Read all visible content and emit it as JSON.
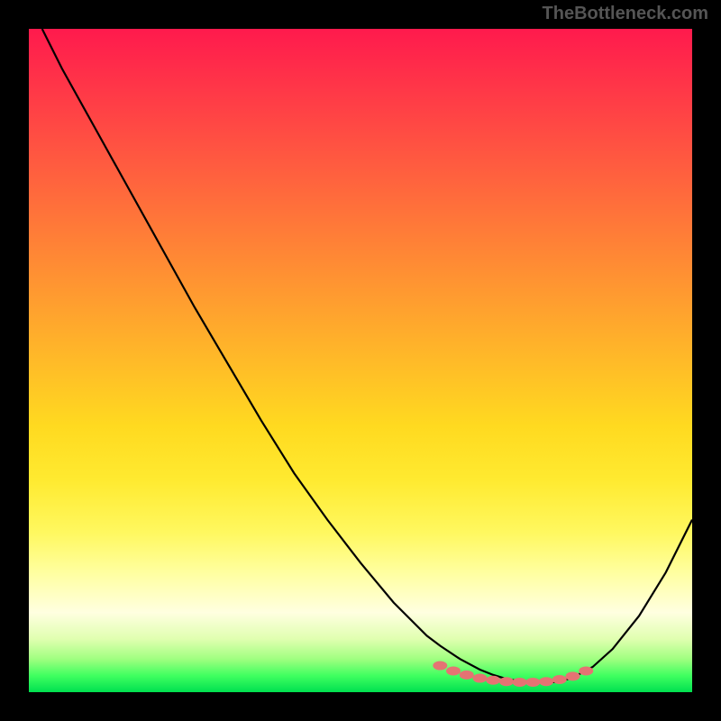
{
  "watermark": "TheBottleneck.com",
  "chart_data": {
    "type": "line",
    "title": "",
    "xlabel": "",
    "ylabel": "",
    "xlim": [
      0,
      100
    ],
    "ylim": [
      0,
      100
    ],
    "curve": {
      "x": [
        2,
        5,
        10,
        15,
        20,
        25,
        30,
        35,
        40,
        45,
        50,
        55,
        60,
        62,
        65,
        68,
        70,
        72,
        75,
        78,
        80,
        82,
        85,
        88,
        92,
        96,
        100
      ],
      "y": [
        100,
        94,
        85,
        76,
        67,
        58,
        49.5,
        41,
        33,
        26,
        19.5,
        13.5,
        8.5,
        7,
        5,
        3.4,
        2.6,
        2.0,
        1.5,
        1.4,
        1.6,
        2.2,
        3.8,
        6.5,
        11.5,
        18,
        26
      ]
    },
    "optimal_points": {
      "x": [
        62,
        64,
        66,
        68,
        70,
        72,
        74,
        76,
        78,
        80,
        82,
        84
      ],
      "y": [
        4.0,
        3.2,
        2.6,
        2.1,
        1.8,
        1.6,
        1.5,
        1.5,
        1.6,
        1.9,
        2.4,
        3.2
      ]
    },
    "colors": {
      "curve": "#000000",
      "points": "#e57373"
    }
  }
}
